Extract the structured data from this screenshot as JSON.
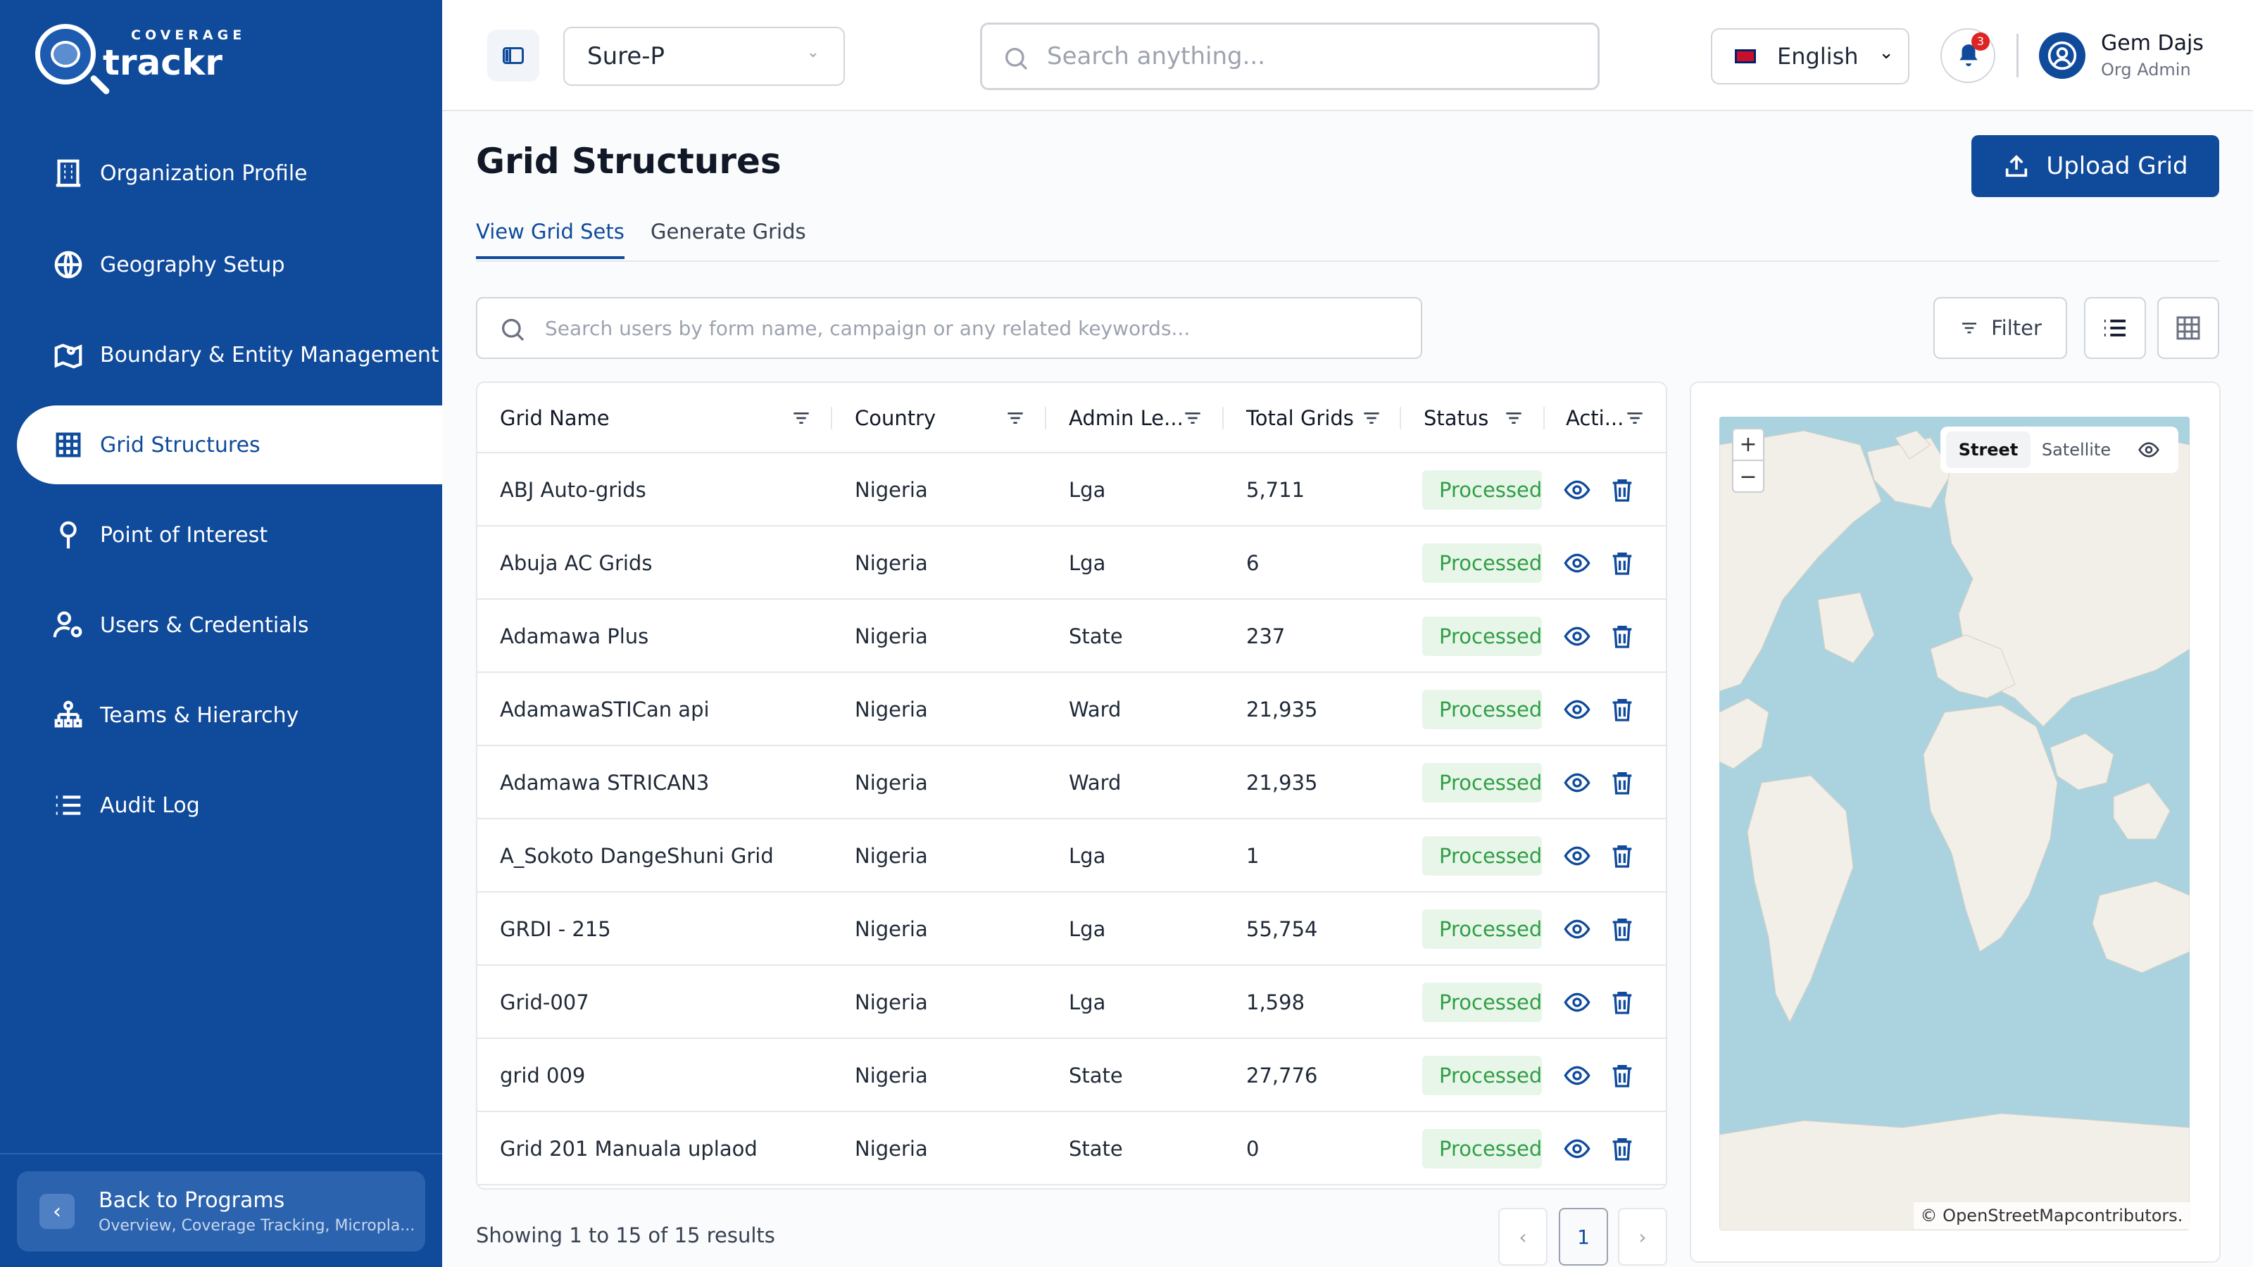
{
  "brand": {
    "small": "COVERAGE",
    "big": "trackr"
  },
  "sidebar": {
    "items": [
      {
        "label": "Organization Profile",
        "icon": "building-icon"
      },
      {
        "label": "Geography Setup",
        "icon": "globe-icon"
      },
      {
        "label": "Boundary & Entity Management",
        "icon": "map-pin-icon"
      },
      {
        "label": "Grid Structures",
        "icon": "grid-icon",
        "active": true
      },
      {
        "label": "Point of Interest",
        "icon": "location-pin-icon"
      },
      {
        "label": "Users & Credentials",
        "icon": "user-gear-icon"
      },
      {
        "label": "Teams & Hierarchy",
        "icon": "hierarchy-icon"
      },
      {
        "label": "Audit Log",
        "icon": "list-icon"
      }
    ],
    "back": {
      "title": "Back to Programs",
      "subtitle": "Overview, Coverage Tracking, Micropla..."
    }
  },
  "header": {
    "program_select": "Sure-P",
    "search_placeholder": "Search anything...",
    "language": "English",
    "notification_count": "3",
    "user_name": "Gem Dajs",
    "user_role": "Org Admin"
  },
  "page": {
    "title": "Grid Structures",
    "upload_label": "Upload Grid",
    "tabs": [
      "View Grid Sets",
      "Generate Grids"
    ],
    "table_search_placeholder": "Search users by form name, campaign or any related keywords...",
    "filter_label": "Filter"
  },
  "table": {
    "columns": [
      "Grid Name",
      "Country",
      "Admin Le...",
      "Total Grids",
      "Status",
      "Acti..."
    ],
    "rows": [
      {
        "name": "ABJ Auto-grids",
        "country": "Nigeria",
        "admin": "Lga",
        "total": "5,711",
        "status": "Processed"
      },
      {
        "name": "Abuja AC Grids",
        "country": "Nigeria",
        "admin": "Lga",
        "total": "6",
        "status": "Processed"
      },
      {
        "name": "Adamawa Plus",
        "country": "Nigeria",
        "admin": "State",
        "total": "237",
        "status": "Processed"
      },
      {
        "name": "AdamawaSTICan api",
        "country": "Nigeria",
        "admin": "Ward",
        "total": "21,935",
        "status": "Processed"
      },
      {
        "name": "Adamawa STRICAN3",
        "country": "Nigeria",
        "admin": "Ward",
        "total": "21,935",
        "status": "Processed"
      },
      {
        "name": "A_Sokoto DangeShuni Grid",
        "country": "Nigeria",
        "admin": "Lga",
        "total": "1",
        "status": "Processed"
      },
      {
        "name": "GRDI - 215",
        "country": "Nigeria",
        "admin": "Lga",
        "total": "55,754",
        "status": "Processed"
      },
      {
        "name": "Grid-007",
        "country": "Nigeria",
        "admin": "Lga",
        "total": "1,598",
        "status": "Processed"
      },
      {
        "name": "grid 009",
        "country": "Nigeria",
        "admin": "State",
        "total": "27,776",
        "status": "Processed"
      },
      {
        "name": "Grid 201 Manuala uplaod",
        "country": "Nigeria",
        "admin": "State",
        "total": "0",
        "status": "Processed"
      }
    ],
    "footer": "Showing 1 to 15 of 15 results",
    "page": "1"
  },
  "map": {
    "layers": [
      "Street",
      "Satellite"
    ],
    "active_layer": "Street",
    "attribution_link": "© OpenStreetMap",
    "attribution_rest": " contributors."
  },
  "colors": {
    "primary": "#0f4a9b",
    "status_green": "#2f9e44",
    "status_bg": "#e8f6ea"
  }
}
